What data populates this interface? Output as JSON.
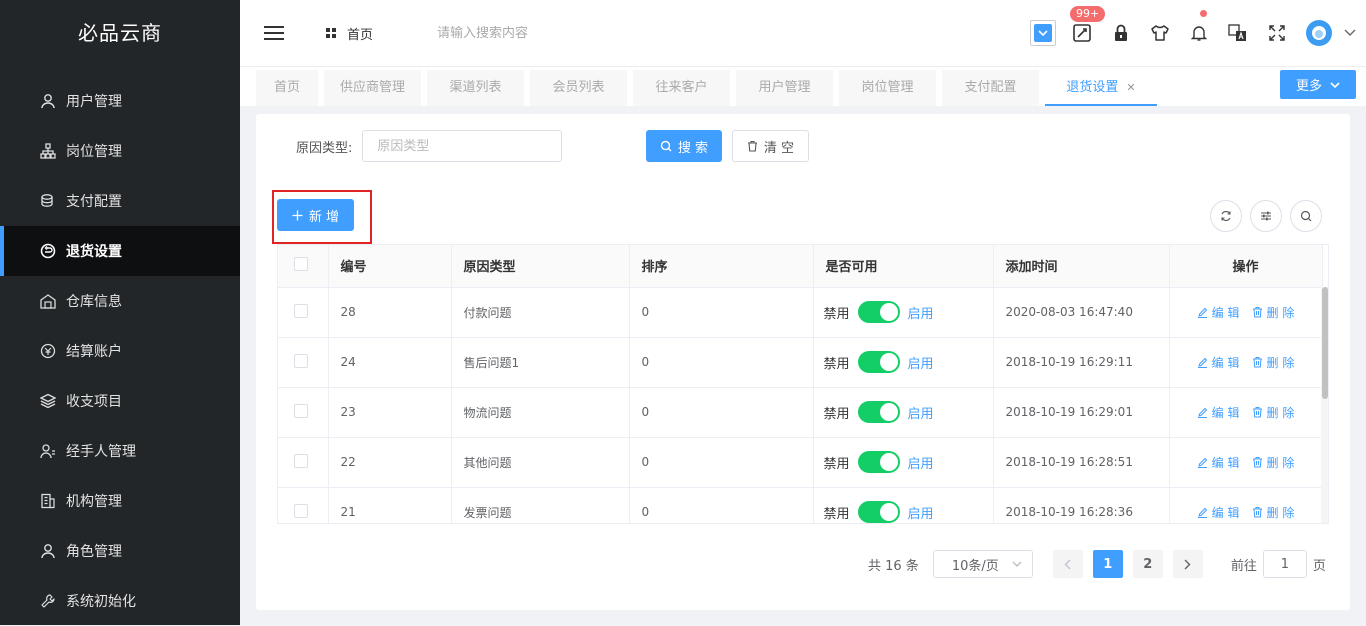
{
  "app": {
    "logo": "必品云商"
  },
  "sidebar": {
    "items": [
      {
        "label": "用户管理",
        "icon": "user-icon"
      },
      {
        "label": "岗位管理",
        "icon": "org-icon"
      },
      {
        "label": "支付配置",
        "icon": "coins-icon"
      },
      {
        "label": "退货设置",
        "icon": "return-icon",
        "active": true
      },
      {
        "label": "仓库信息",
        "icon": "warehouse-icon"
      },
      {
        "label": "结算账户",
        "icon": "account-icon"
      },
      {
        "label": "收支项目",
        "icon": "layers-icon"
      },
      {
        "label": "经手人管理",
        "icon": "handler-icon"
      },
      {
        "label": "机构管理",
        "icon": "building-icon"
      },
      {
        "label": "角色管理",
        "icon": "role-icon"
      },
      {
        "label": "系统初始化",
        "icon": "wrench-icon"
      }
    ]
  },
  "topbar": {
    "home_label": "首页",
    "search_placeholder": "请输入搜索内容",
    "badge_count": "99+"
  },
  "tabs": [
    {
      "label": "首页",
      "width": 62
    },
    {
      "label": "供应商管理",
      "width": 97
    },
    {
      "label": "渠道列表",
      "width": 97
    },
    {
      "label": "会员列表",
      "width": 97
    },
    {
      "label": "往来客户",
      "width": 97
    },
    {
      "label": "用户管理",
      "width": 97
    },
    {
      "label": "岗位管理",
      "width": 97
    },
    {
      "label": "支付配置",
      "width": 97
    },
    {
      "label": "退货设置",
      "width": 112,
      "active": true
    }
  ],
  "tabs_more": "更多",
  "filter": {
    "label": "原因类型:",
    "placeholder": "原因类型",
    "search_btn": "搜 索",
    "clear_btn": "清 空"
  },
  "add_btn": "新 增",
  "table": {
    "columns": [
      "编号",
      "原因类型",
      "排序",
      "是否可用",
      "添加时间",
      "操作"
    ],
    "switch_off_label": "禁用",
    "switch_on_label": "启用",
    "edit_label": "编 辑",
    "delete_label": "删 除",
    "rows": [
      {
        "id": "28",
        "type": "付款问题",
        "sort": "0",
        "enabled": true,
        "time": "2020-08-03 16:47:40"
      },
      {
        "id": "24",
        "type": "售后问题1",
        "sort": "0",
        "enabled": true,
        "time": "2018-10-19 16:29:11"
      },
      {
        "id": "23",
        "type": "物流问题",
        "sort": "0",
        "enabled": true,
        "time": "2018-10-19 16:29:01"
      },
      {
        "id": "22",
        "type": "其他问题",
        "sort": "0",
        "enabled": true,
        "time": "2018-10-19 16:28:51"
      },
      {
        "id": "21",
        "type": "发票问题",
        "sort": "0",
        "enabled": true,
        "time": "2018-10-19 16:28:36"
      }
    ]
  },
  "pagination": {
    "total": "共 16 条",
    "page_size": "10条/页",
    "pages": [
      "1",
      "2"
    ],
    "current": "1",
    "goto_label": "前往",
    "goto_value": "1",
    "page_suffix": "页"
  },
  "colors": {
    "accent": "#409eff",
    "sidebar_bg": "#222629",
    "switch_on": "#13ce66",
    "badge": "#f56c6c",
    "highlight": "#e02424"
  }
}
